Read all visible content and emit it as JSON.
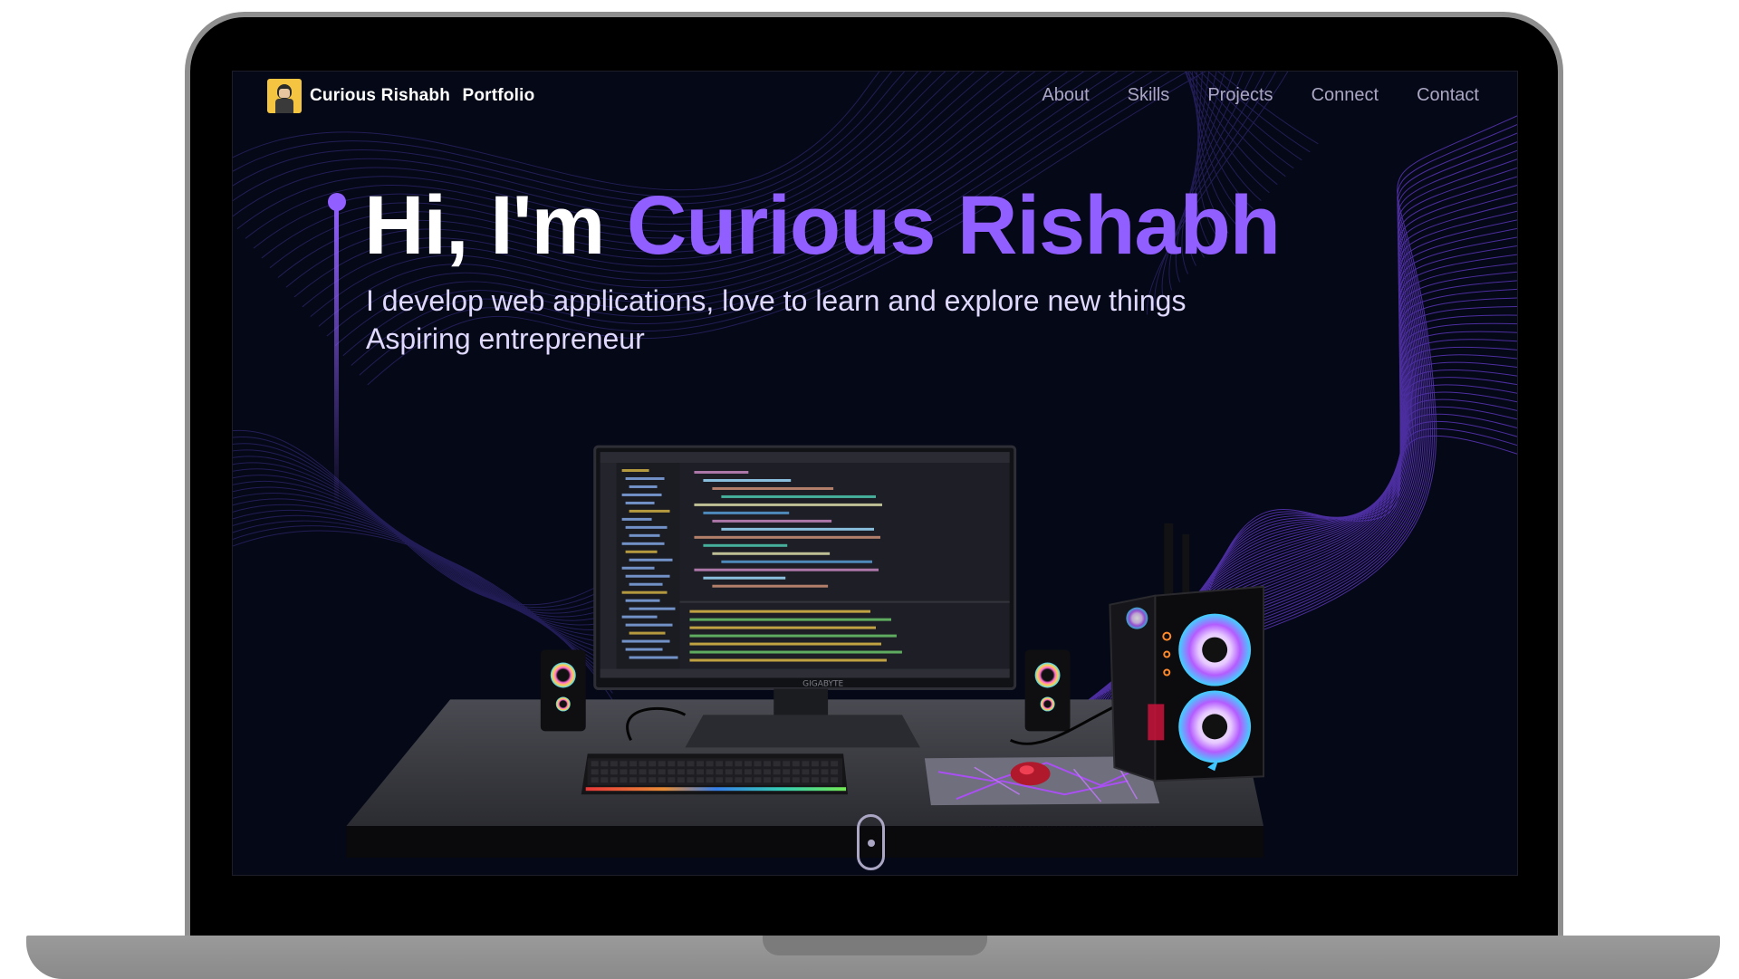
{
  "brand": {
    "name": "Curious Rishabh",
    "suffix": "Portfolio"
  },
  "nav": {
    "links": [
      "About",
      "Skills",
      "Projects",
      "Connect",
      "Contact"
    ]
  },
  "hero": {
    "greeting": "Hi, I'm ",
    "name": "Curious Rishabh",
    "line1": "I develop web applications, love to learn and explore new things",
    "line2": "Aspiring entrepreneur"
  },
  "colors": {
    "background": "#050816",
    "accent": "#915eff",
    "nav_text": "#aaa6c3",
    "subtitle": "#dfd9ff"
  },
  "icons": {
    "brand": "avatar-logo-icon",
    "scroll": "scroll-mouse-icon"
  },
  "scene": {
    "monitor_brand": "GIGABYTE"
  }
}
